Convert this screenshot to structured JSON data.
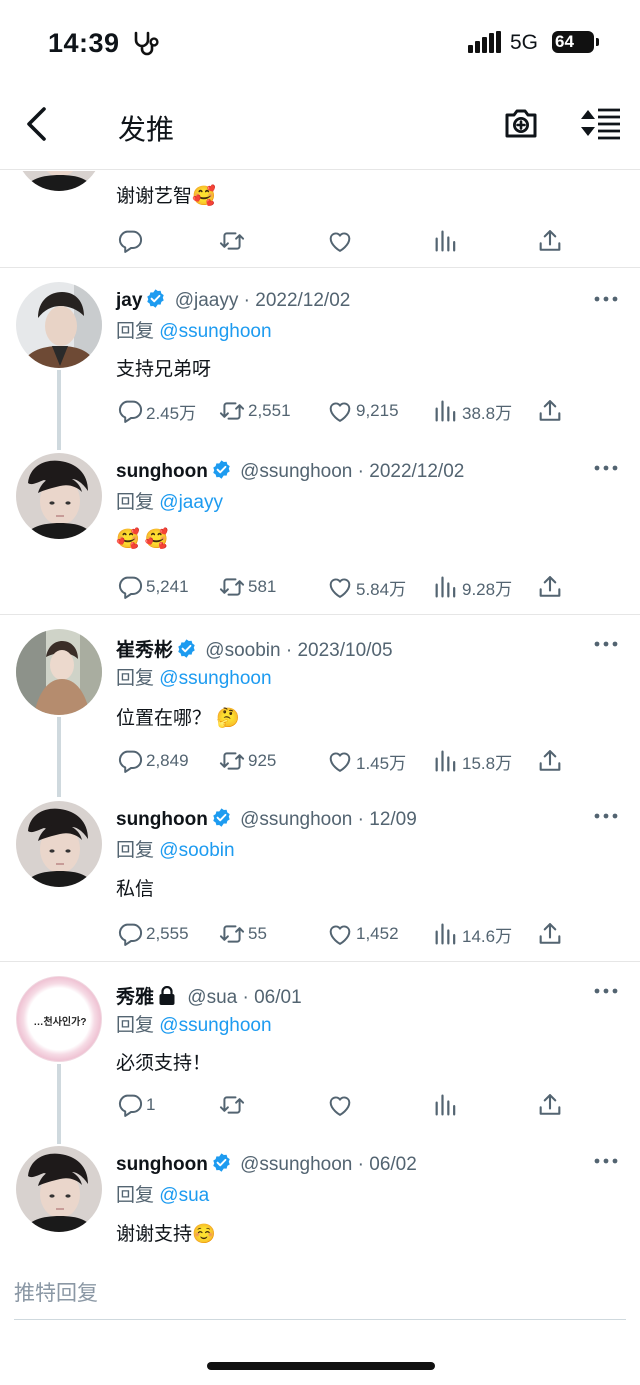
{
  "status_bar": {
    "time": "14:39",
    "network": "5G",
    "battery": "64"
  },
  "header": {
    "title": "发推"
  },
  "top_tweet": {
    "text": "谢谢艺智🥰"
  },
  "tweets": [
    {
      "name": "jay",
      "handle": "@jaayy",
      "date": "2022/12/02",
      "reply_label": "回复",
      "reply_to": "@ssunghoon",
      "text": "支持兄弟呀",
      "replies": "2.45万",
      "retweets": "2,551",
      "likes": "9,215",
      "views": "38.8万"
    },
    {
      "name": "sunghoon",
      "handle": "@ssunghoon",
      "date": "2022/12/02",
      "reply_label": "回复",
      "reply_to": "@jaayy",
      "text": "🥰 🥰",
      "replies": "5,241",
      "retweets": "581",
      "likes": "5.84万",
      "views": "9.28万"
    },
    {
      "name": "崔秀彬",
      "handle": "@soobin",
      "date": "2023/10/05",
      "reply_label": "回复",
      "reply_to": "@ssunghoon",
      "text": "位置在哪？ 🤔",
      "replies": "2,849",
      "retweets": "925",
      "likes": "1.45万",
      "views": "15.8万"
    },
    {
      "name": "sunghoon",
      "handle": "@ssunghoon",
      "date": "12/09",
      "reply_label": "回复",
      "reply_to": "@soobin",
      "text": "私信",
      "replies": "2,555",
      "retweets": "55",
      "likes": "1,452",
      "views": "14.6万"
    },
    {
      "name": "秀雅",
      "handle": "@sua",
      "date": "06/01",
      "reply_label": "回复",
      "reply_to": "@ssunghoon",
      "text": "必须支持！",
      "replies": "1",
      "retweets": "",
      "likes": "",
      "views": "",
      "avatar_text": "…천사인가?"
    },
    {
      "name": "sunghoon",
      "handle": "@ssunghoon",
      "date": "06/02",
      "reply_label": "回复",
      "reply_to": "@sua",
      "text": "谢谢支持☺️"
    }
  ],
  "compose": {
    "placeholder": "推特回复"
  },
  "colors": {
    "accent": "#1d9bf0",
    "muted": "#536471",
    "thread_line": "#cfd9de"
  },
  "icons": [
    "back-icon",
    "camera-plus-icon",
    "sort-icon",
    "reply-icon",
    "retweet-icon",
    "like-icon",
    "views-icon",
    "share-icon",
    "more-icon",
    "verified-icon",
    "lock-icon"
  ]
}
